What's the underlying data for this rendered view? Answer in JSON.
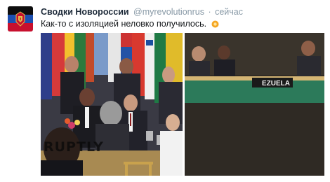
{
  "tweet": {
    "account_name": "Сводки Новороссии",
    "handle": "@myrevolutionrus",
    "separator": "·",
    "time": "сейчас",
    "text": "Как-то с изоляцией неловко получилось.",
    "emoji_icon": "yellow-dot-emoji"
  },
  "media": {
    "left_watermark": "RUPTLY",
    "right_nameplate_partial": "EZUELA"
  },
  "colors": {
    "name": "#1c2938",
    "meta": "#8899a6",
    "text": "#14171a",
    "emoji": "#f5a623"
  }
}
